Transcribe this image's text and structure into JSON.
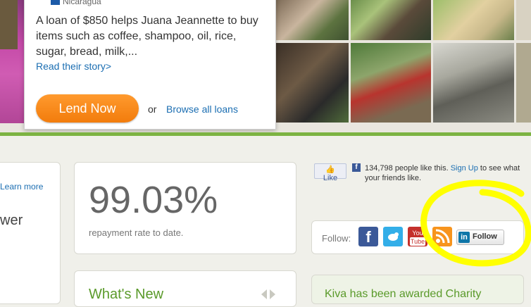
{
  "loan": {
    "country": "Nicaragua",
    "description": "A loan of $850 helps Juana Jeannette to buy items such as coffee, shampoo, oil, rice, sugar, bread, milk,...",
    "story_link": "Read their story>",
    "lend_button": "Lend Now",
    "or": "or",
    "browse_link": "Browse all loans"
  },
  "left_card": {
    "learn_more": "Learn more",
    "partial_word": "wer"
  },
  "stats": {
    "repayment_rate": "99.03%",
    "caption": "repayment rate to date.",
    "whats_new": "What's New"
  },
  "facebook": {
    "like_button": "Like",
    "count_text": "134,798 people like this.",
    "sign_up": "Sign Up",
    "suffix": "to see what your friends like."
  },
  "follow": {
    "label": "Follow:",
    "icons": [
      "facebook-icon",
      "twitter-icon",
      "youtube-icon",
      "rss-icon",
      "linkedin-icon"
    ],
    "linkedin_button": "Follow"
  },
  "kiva": {
    "text": "Kiva has been awarded Charity"
  },
  "colors": {
    "accent_green": "#7cb342",
    "lend_orange": "#f27c0c",
    "link_blue": "#1b6eb2",
    "annotation_yellow": "#ffff00"
  }
}
